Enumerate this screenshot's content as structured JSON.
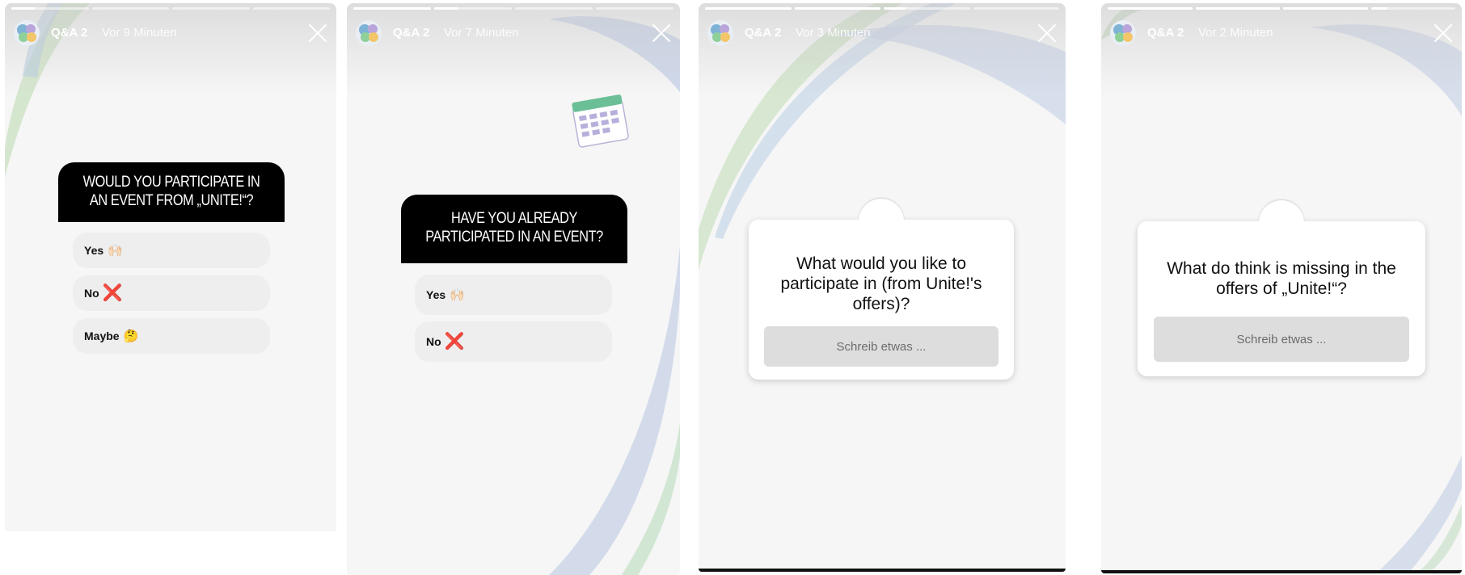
{
  "stories": [
    {
      "account": "Q&A 2",
      "time": "Vor 9 Minuten",
      "type": "poll",
      "question": "WOULD YOU PARTICIPATE IN AN EVENT FROM „UNITE!“?",
      "options": [
        {
          "label": "Yes",
          "emoji": "🙌🏻"
        },
        {
          "label": "No",
          "emoji": "❌"
        },
        {
          "label": "Maybe",
          "emoji": "🤔"
        }
      ]
    },
    {
      "account": "Q&A 2",
      "time": "Vor 7 Minuten",
      "type": "poll",
      "question": "HAVE YOU ALREADY PARTICIPATED IN AN EVENT?",
      "options": [
        {
          "label": "Yes",
          "emoji": "🙌🏻"
        },
        {
          "label": "No",
          "emoji": "❌"
        }
      ]
    },
    {
      "account": "Q&A 2",
      "time": "Vor 3 Minuten",
      "type": "question",
      "question": "What would you like to participate in (from Unite!'s offers)?",
      "placeholder": "Schreib etwas ..."
    },
    {
      "account": "Q&A 2",
      "time": "Vor 2 Minuten",
      "type": "question",
      "question": "What do think is missing in the offers of „Unite!“?",
      "placeholder": "Schreib etwas ..."
    }
  ],
  "icons": {
    "avatar": "account-avatar-icon",
    "close": "close-icon",
    "calendar": "calendar-sticker-icon"
  },
  "colors": {
    "poll_header_bg": "#000000",
    "option_bg": "#eeeeee",
    "answer_bg": "#dddddd",
    "no_mark": "#e2222b"
  }
}
